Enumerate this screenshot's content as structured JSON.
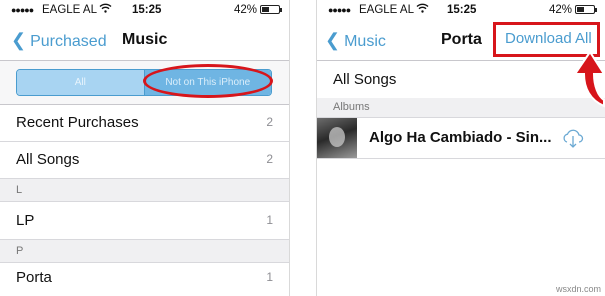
{
  "left": {
    "status": {
      "carrier": "EAGLE AL",
      "time": "15:25",
      "battery": "42%"
    },
    "nav": {
      "back_label": "Purchased",
      "title": "Music"
    },
    "segment": {
      "all": "All",
      "not_on_iphone": "Not on This iPhone"
    },
    "rows": [
      {
        "label": "Recent Purchases",
        "count": "2"
      },
      {
        "label": "All Songs",
        "count": "2"
      }
    ],
    "section_l": "L",
    "row_lp": {
      "label": "LP",
      "count": "1"
    },
    "section_p": "P",
    "row_porta": {
      "label": "Porta",
      "count": "1"
    }
  },
  "right": {
    "status": {
      "carrier": "EAGLE AL",
      "time": "15:25",
      "battery": "42%"
    },
    "nav": {
      "back_label": "Music",
      "title": "Porta",
      "download_all": "Download All"
    },
    "all_songs": "All Songs",
    "section_albums": "Albums",
    "album": {
      "title": "Algo Ha Cambiado - Sin..."
    }
  },
  "watermark": "wsxdn.com",
  "colors": {
    "accent": "#4a9ccf",
    "highlight": "#d7151b"
  }
}
